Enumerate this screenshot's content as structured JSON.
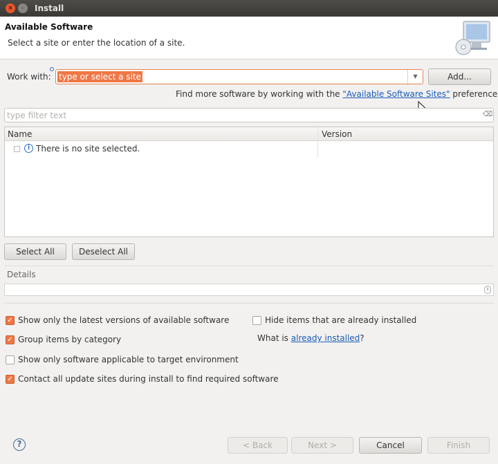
{
  "window": {
    "title": "Install"
  },
  "header": {
    "title": "Available Software",
    "subtitle": "Select a site or enter the location of a site."
  },
  "work_with": {
    "label": "Work with:",
    "value": "type or select a site",
    "add_label": "Add..."
  },
  "find_more": {
    "prefix": "Find more software by working with the ",
    "link": "\"Available Software Sites\"",
    "suffix": " preferences."
  },
  "filter": {
    "placeholder": "type filter text"
  },
  "table": {
    "columns": [
      "Name",
      "Version"
    ],
    "rows": [
      {
        "name": "There is no site selected.",
        "version": ""
      }
    ]
  },
  "selection": {
    "select_all": "Select All",
    "deselect_all": "Deselect All"
  },
  "details": {
    "label": "Details",
    "text": ""
  },
  "options": {
    "latest_versions": {
      "label": "Show only the latest versions of available software",
      "checked": true
    },
    "group_by_category": {
      "label": "Group items by category",
      "checked": true
    },
    "target_env": {
      "label": "Show only software applicable to target environment",
      "checked": false
    },
    "contact_sites": {
      "label": "Contact all update sites during install to find required software",
      "checked": true
    },
    "hide_installed": {
      "label": "Hide items that are already installed",
      "checked": false
    },
    "what_is_prefix": "What is ",
    "what_is_link": "already installed",
    "what_is_suffix": "?"
  },
  "footer": {
    "back": "< Back",
    "next": "Next >",
    "cancel": "Cancel",
    "finish": "Finish"
  },
  "colors": {
    "accent": "#f07746",
    "link": "#1a5cb8"
  }
}
